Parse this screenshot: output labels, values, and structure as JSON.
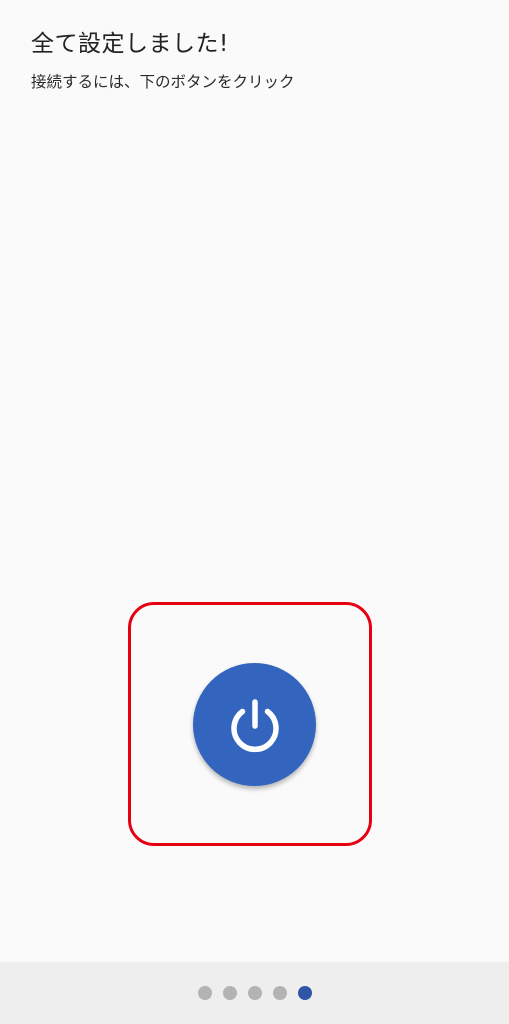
{
  "header": {
    "title": "全て設定しました!",
    "subtitle": "接続するには、下のボタンをクリック"
  },
  "power_button": {
    "icon": "power-icon",
    "color": "#3465be"
  },
  "highlight": {
    "color": "#e60012"
  },
  "pager": {
    "total_pages": 5,
    "current_page": 5,
    "active_color": "#2f56a6",
    "inactive_color": "#b3b3b3"
  }
}
